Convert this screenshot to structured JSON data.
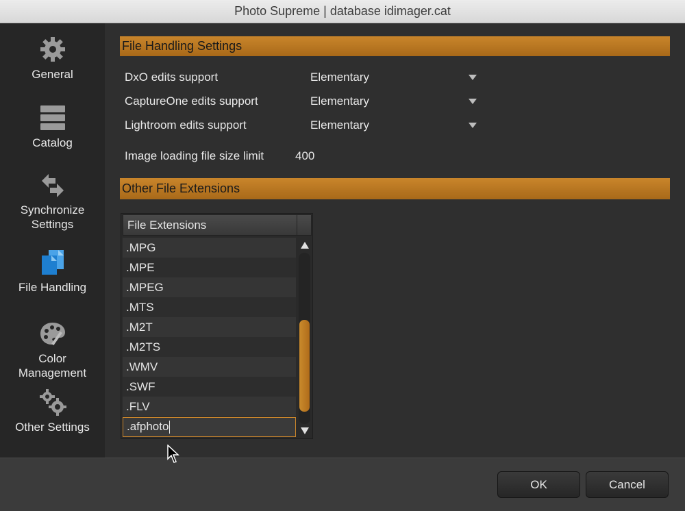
{
  "window": {
    "title": "Photo Supreme | database idimager.cat"
  },
  "sidebar": {
    "items": [
      {
        "label": "General",
        "icon": "gear-icon"
      },
      {
        "label": "Catalog",
        "icon": "stack-icon"
      },
      {
        "label": "Synchronize\nSettings",
        "line1": "Synchronize",
        "line2": "Settings",
        "icon": "sync-arrows-icon"
      },
      {
        "label": "File Handling",
        "icon": "files-icon"
      },
      {
        "label": "Color Management",
        "line1": "Color",
        "line2": "Management",
        "icon": "palette-icon"
      },
      {
        "label": "Other Settings",
        "icon": "gears-icon"
      }
    ]
  },
  "file_handling": {
    "header": "File Handling Settings",
    "rows": [
      {
        "label": "DxO edits support",
        "value": "Elementary"
      },
      {
        "label": "CaptureOne edits support",
        "value": "Elementary"
      },
      {
        "label": "Lightroom edits support",
        "value": "Elementary"
      }
    ],
    "size_limit": {
      "label": "Image loading file size limit",
      "value": "400"
    }
  },
  "other_extensions": {
    "header": "Other File Extensions",
    "column_header": "File Extensions",
    "items": [
      ".MPG",
      ".MPE",
      ".MPEG",
      ".MTS",
      ".M2T",
      ".M2TS",
      ".WMV",
      ".SWF",
      ".FLV"
    ],
    "editing_value": ".afphoto"
  },
  "footer": {
    "ok_label": "OK",
    "cancel_label": "Cancel"
  },
  "colors": {
    "accent": "#c9852b",
    "sidebar_bg": "#262626",
    "panel_bg": "#2f2f2f"
  }
}
